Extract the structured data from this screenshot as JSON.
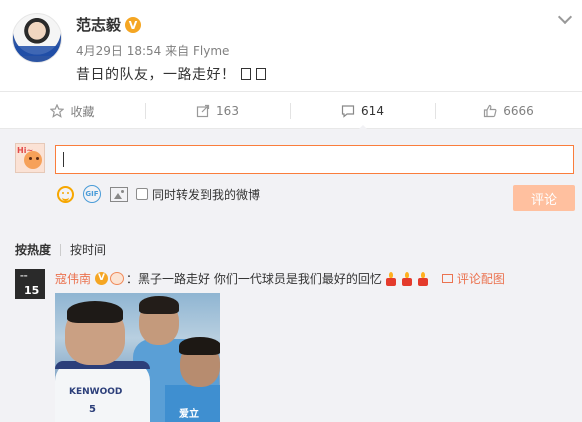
{
  "post": {
    "author": "范志毅",
    "verified_badge": "V",
    "date": "4月29日 18:54",
    "source_prefix": "来自",
    "source": "Flyme",
    "text": "昔日的队友，一路走好！"
  },
  "actions": {
    "favorite": "收藏",
    "repost_count": "163",
    "comment_count": "614",
    "like_count": "6666"
  },
  "composer": {
    "input_value": "",
    "avatar_text": "Hi~",
    "repost_checkbox_label": "同时转发到我的微博",
    "checkbox_checked": false,
    "submit_label": "评论",
    "gif_label": "GIF"
  },
  "sort": {
    "by_hot": "按热度",
    "by_time": "按时间"
  },
  "comments": [
    {
      "name": "寇伟南",
      "verified_badge": "V",
      "text": "：黑子一路走好 你们一代球员是我们最好的回忆",
      "pic_link": "评论配图",
      "avatar_number": "15",
      "photo_text_1": "KENWOOD",
      "photo_text_2": "5",
      "photo_text_3": "爱立"
    }
  ],
  "colors": {
    "accent": "#eb7350",
    "input_border": "#fa7d3c",
    "submit_bg": "#ffc09f",
    "panel_bg": "#f2f2f5",
    "verified": "#f5a623"
  },
  "icons": {
    "favorite": "star-icon",
    "repost": "repost-icon",
    "comment": "comment-icon",
    "like": "thumbs-up-icon",
    "menu": "chevron-down-icon",
    "emoji": "smile-icon",
    "gif": "gif-icon",
    "image": "image-icon"
  }
}
